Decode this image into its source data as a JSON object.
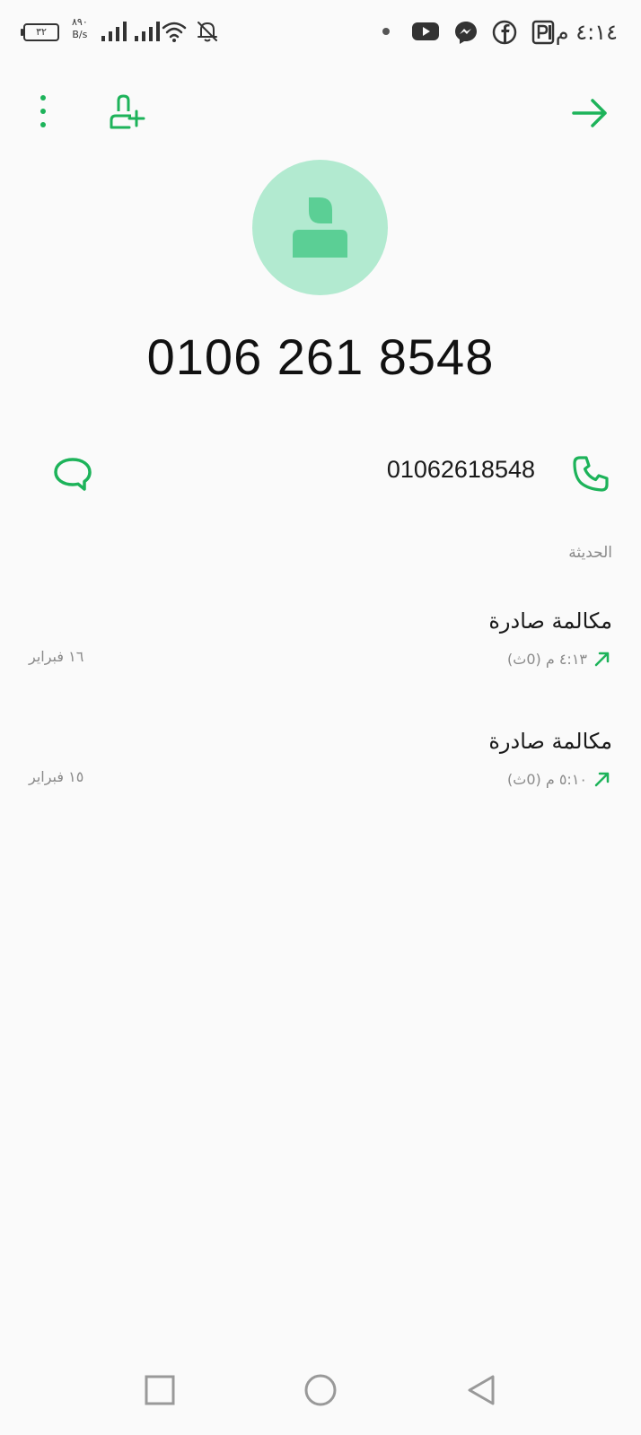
{
  "status_bar": {
    "time": "٤:١٤ م",
    "battery": "٣٢",
    "net_speed_value": "٨٩٠",
    "net_speed_unit": "B/s",
    "icons": [
      "battery-icon",
      "signal-icon",
      "wifi-icon",
      "bell-off-icon",
      "dot-icon",
      "youtube-icon",
      "messenger-icon",
      "facebook-icon",
      "parking-icon"
    ]
  },
  "toolbar": {
    "icons": [
      "more-vertical-icon",
      "add-contact-icon",
      "forward-arrow-icon"
    ]
  },
  "contact": {
    "display_number": "0106 261 8548",
    "number": "01062618548"
  },
  "recent": {
    "section_title": "الحديثة",
    "calls": [
      {
        "title": "مكالمة صادرة",
        "time": "٤:١٣ م (0ث)",
        "date": "١٦ فبراير"
      },
      {
        "title": "مكالمة صادرة",
        "time": "٥:١٠ م (0ث)",
        "date": "١٥ فبراير"
      }
    ]
  },
  "colors": {
    "accent": "#1db35a",
    "avatar_bg": "#b2ead0",
    "avatar_fg": "#5bcf95",
    "text_primary": "#1a1a1a",
    "text_secondary": "#8a8a8a",
    "background": "#fafafa"
  }
}
